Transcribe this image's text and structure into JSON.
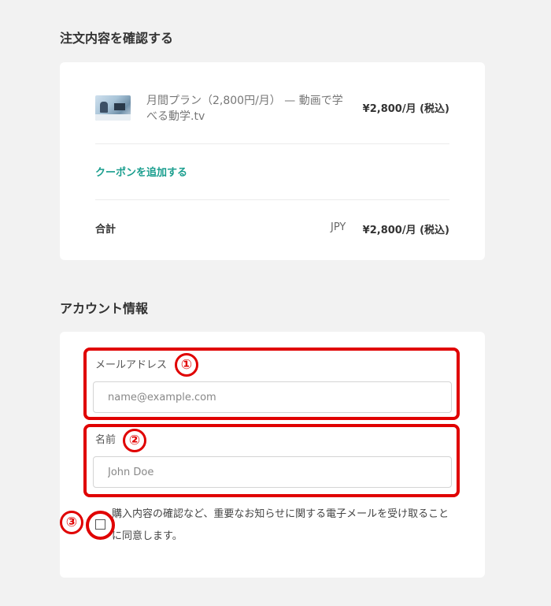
{
  "order": {
    "title": "注文内容を確認する",
    "product": {
      "name": "月間プラン（2,800円/月） — 動画で学べる動学.tv",
      "price": "¥2,800/月 (税込)",
      "thumbnail_icon": "product-thumbnail-image"
    },
    "coupon_link": "クーポンを追加する",
    "total": {
      "label": "合計",
      "currency": "JPY",
      "price": "¥2,800/月 (税込)"
    }
  },
  "account": {
    "title": "アカウント情報",
    "email": {
      "label": "メールアドレス",
      "placeholder": "name@example.com",
      "value": ""
    },
    "name": {
      "label": "名前",
      "placeholder": "John Doe",
      "value": ""
    },
    "consent": {
      "text": "購入内容の確認など、重要なお知らせに関する電子メールを受け取ることに同意します。",
      "checked": false
    }
  },
  "annotations": {
    "color": "#e00000",
    "markers": [
      "①",
      "②",
      "③"
    ]
  },
  "colors": {
    "background": "#f2f2f2",
    "card": "#ffffff",
    "link_accent": "#1a9e8e"
  }
}
